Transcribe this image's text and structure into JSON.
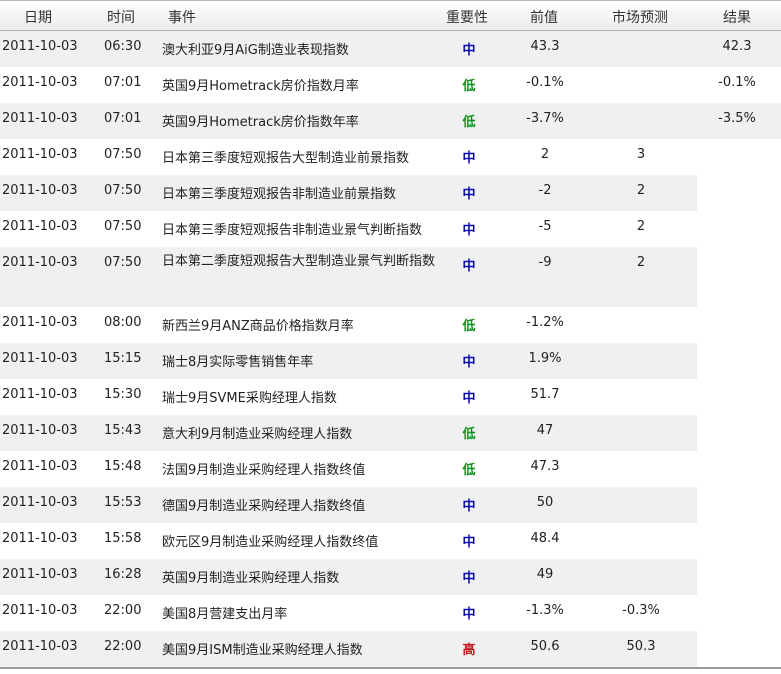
{
  "header": {
    "date": "日期",
    "time": "时间",
    "event": "事件",
    "importance": "重要性",
    "previous": "前值",
    "forecast": "市场预测",
    "result": "结果"
  },
  "importance_colors": {
    "中": "#0a0aa8",
    "低": "#14901c",
    "高": "#c8141c"
  },
  "rows": [
    {
      "date": "2011-10-03",
      "time": "06:30",
      "event": "澳大利亚9月AiG制造业表现指数",
      "importance": "中",
      "previous": "43.3",
      "forecast": "",
      "result": "42.3"
    },
    {
      "date": "2011-10-03",
      "time": "07:01",
      "event": "英国9月Hometrack房价指数月率",
      "importance": "低",
      "previous": "-0.1%",
      "forecast": "",
      "result": "-0.1%"
    },
    {
      "date": "2011-10-03",
      "time": "07:01",
      "event": "英国9月Hometrack房价指数年率",
      "importance": "低",
      "previous": "-3.7%",
      "forecast": "",
      "result": "-3.5%"
    },
    {
      "date": "2011-10-03",
      "time": "07:50",
      "event": "日本第三季度短观报告大型制造业前景指数",
      "importance": "中",
      "previous": "2",
      "forecast": "3",
      "result": ""
    },
    {
      "date": "2011-10-03",
      "time": "07:50",
      "event": "日本第三季度短观报告非制造业前景指数",
      "importance": "中",
      "previous": "-2",
      "forecast": "2",
      "result": ""
    },
    {
      "date": "2011-10-03",
      "time": "07:50",
      "event": "日本第三季度短观报告非制造业景气判断指数",
      "importance": "中",
      "previous": "-5",
      "forecast": "2",
      "result": ""
    },
    {
      "date": "2011-10-03",
      "time": "07:50",
      "event": "日本第二季度短观报告大型制造业景气判断指数",
      "importance": "中",
      "previous": "-9",
      "forecast": "2",
      "result": ""
    },
    {
      "date": "2011-10-03",
      "time": "08:00",
      "event": "新西兰9月ANZ商品价格指数月率",
      "importance": "低",
      "previous": "-1.2%",
      "forecast": "",
      "result": ""
    },
    {
      "date": "2011-10-03",
      "time": "15:15",
      "event": "瑞士8月实际零售销售年率",
      "importance": "中",
      "previous": "1.9%",
      "forecast": "",
      "result": ""
    },
    {
      "date": "2011-10-03",
      "time": "15:30",
      "event": "瑞士9月SVME采购经理人指数",
      "importance": "中",
      "previous": "51.7",
      "forecast": "",
      "result": ""
    },
    {
      "date": "2011-10-03",
      "time": "15:43",
      "event": "意大利9月制造业采购经理人指数",
      "importance": "低",
      "previous": "47",
      "forecast": "",
      "result": ""
    },
    {
      "date": "2011-10-03",
      "time": "15:48",
      "event": "法国9月制造业采购经理人指数终值",
      "importance": "低",
      "previous": "47.3",
      "forecast": "",
      "result": ""
    },
    {
      "date": "2011-10-03",
      "time": "15:53",
      "event": "德国9月制造业采购经理人指数终值",
      "importance": "中",
      "previous": "50",
      "forecast": "",
      "result": ""
    },
    {
      "date": "2011-10-03",
      "time": "15:58",
      "event": "欧元区9月制造业采购经理人指数终值",
      "importance": "中",
      "previous": "48.4",
      "forecast": "",
      "result": ""
    },
    {
      "date": "2011-10-03",
      "time": "16:28",
      "event": "英国9月制造业采购经理人指数",
      "importance": "中",
      "previous": "49",
      "forecast": "",
      "result": ""
    },
    {
      "date": "2011-10-03",
      "time": "22:00",
      "event": "美国8月营建支出月率",
      "importance": "中",
      "previous": "-1.3%",
      "forecast": "-0.3%",
      "result": ""
    },
    {
      "date": "2011-10-03",
      "time": "22:00",
      "event": "美国9月ISM制造业采购经理人指数",
      "importance": "高",
      "previous": "50.6",
      "forecast": "50.3",
      "result": ""
    }
  ]
}
